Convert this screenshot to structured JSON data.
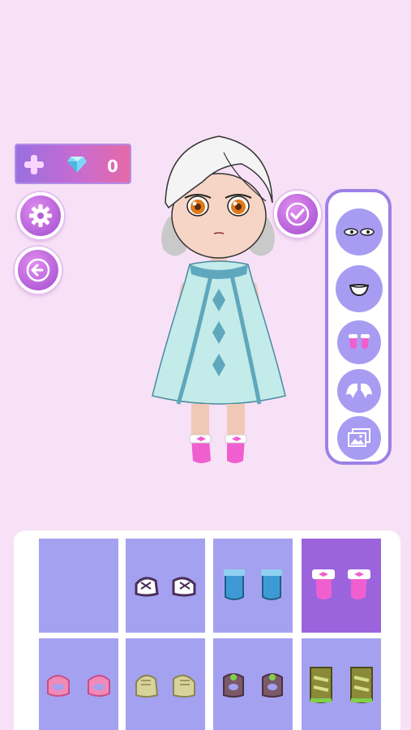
{
  "hud": {
    "gem_count": "0"
  },
  "icons": {
    "add_gems": "plus-icon",
    "gem": "diamond-icon",
    "settings": "gear-icon",
    "back": "arrow-left-icon",
    "confirm": "checkmark-icon"
  },
  "categories": [
    {
      "name": "eyes-category",
      "icon": "eyes-icon"
    },
    {
      "name": "mouth-category",
      "icon": "mouth-icon"
    },
    {
      "name": "shoes-category",
      "icon": "shoes-icon"
    },
    {
      "name": "wings-category",
      "icon": "wings-icon"
    },
    {
      "name": "background-category",
      "icon": "picture-icon"
    }
  ],
  "items": [
    {
      "name": "none",
      "selected": false
    },
    {
      "name": "purple-sneakers",
      "selected": false
    },
    {
      "name": "blue-boots",
      "selected": false
    },
    {
      "name": "pink-bow-socks",
      "selected": true
    },
    {
      "name": "pink-sandals",
      "selected": false
    },
    {
      "name": "khaki-sneakers",
      "selected": false
    },
    {
      "name": "brown-green-sandals",
      "selected": false
    },
    {
      "name": "olive-boots",
      "selected": false
    }
  ],
  "colors": {
    "background": "#f7e1f6",
    "accent": "#b45fd8",
    "tile": "#a5a1f1",
    "tile_selected": "#9c64dc"
  }
}
